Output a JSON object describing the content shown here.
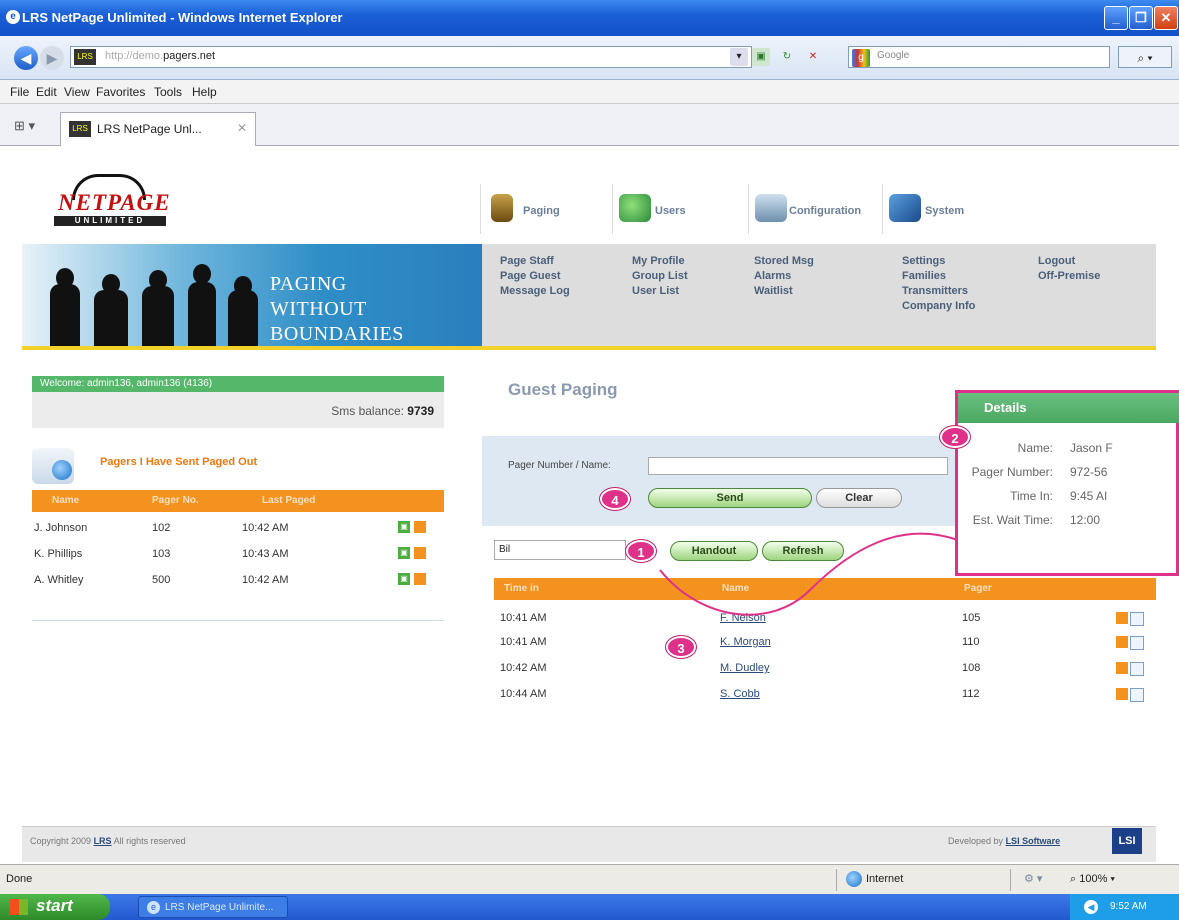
{
  "window": {
    "title": "LRS NetPage Unlimited - Windows Internet Explorer"
  },
  "browser": {
    "url_faded": "http://demo.",
    "url_host": "pagers.net",
    "search_placeholder": "Google",
    "menu": [
      "File",
      "Edit",
      "View",
      "Favorites",
      "Tools",
      "Help"
    ],
    "tab_title": "LRS NetPage Unl...",
    "tab_close": "✕"
  },
  "logo": {
    "word": "NETPAGE",
    "sub": "UNLIMITED"
  },
  "banner": {
    "line1": "PAGING",
    "line2": "WITHOUT BOUNDARIES"
  },
  "nav": {
    "tabs": [
      "Paging",
      "Users",
      "Configuration",
      "System"
    ],
    "columns": [
      [
        "Page Staff",
        "Page Guest",
        "Message Log"
      ],
      [
        "My Profile",
        "Group List",
        "User List"
      ],
      [
        "Stored Msg",
        "Alarms",
        "Waitlist"
      ],
      [
        "Settings",
        "Families",
        "Transmitters",
        "Company Info"
      ],
      [
        "Logout",
        "Off-Premise"
      ]
    ]
  },
  "sidebar": {
    "welcome": "Welcome: admin136, admin136 (4136)",
    "sms_label": "Sms balance:",
    "sms_value": "9739",
    "paged_label": "Pagers I Have Sent Paged Out",
    "table_headers": [
      "Name",
      "Pager No.",
      "Last Paged"
    ],
    "rows": [
      {
        "name": "J. Johnson",
        "pager": "102",
        "time": "10:42 AM"
      },
      {
        "name": "K. Phillips",
        "pager": "103",
        "time": "10:43 AM"
      },
      {
        "name": "A. Whitley",
        "pager": "500",
        "time": "10:42 AM"
      }
    ]
  },
  "guest": {
    "title": "Guest Paging",
    "pager_label": "Pager Number / Name:",
    "send": "Send",
    "clear": "Clear",
    "filter_value": "Bil",
    "handout": "Handout",
    "refresh": "Refresh",
    "table_headers": [
      "Time in",
      "Name",
      "Pager"
    ],
    "rows": [
      {
        "time": "10:41 AM",
        "name": "F. Nelson",
        "pager": "105"
      },
      {
        "time": "10:41 AM",
        "name": "K. Morgan",
        "pager": "110"
      },
      {
        "time": "10:42 AM",
        "name": "M. Dudley",
        "pager": "108"
      },
      {
        "time": "10:44 AM",
        "name": "S. Cobb",
        "pager": "112"
      }
    ]
  },
  "details": {
    "title": "Details",
    "rows": [
      {
        "label": "Name:",
        "value": "Jason F"
      },
      {
        "label": "Pager Number:",
        "value": "972-56"
      },
      {
        "label": "Time In:",
        "value": "9:45 AI"
      },
      {
        "label": "Est. Wait Time:",
        "value": "12:00"
      }
    ]
  },
  "badges": [
    "1",
    "2",
    "3",
    "4"
  ],
  "footer": {
    "copyright_prefix": "Copyright 2009",
    "copyright_link": "LRS",
    "copyright_suffix": "All rights reserved",
    "dev_prefix": "Developed by",
    "dev_link": "LSI Software",
    "lsi_logo": "LSI"
  },
  "status": {
    "done": "Done",
    "zone": "Internet",
    "zoom": "100%"
  },
  "taskbar": {
    "start": "start",
    "task": "LRS NetPage Unlimite...",
    "clock": "9:52 AM"
  },
  "colors": {
    "accent_orange": "#f3921f",
    "welcome_green": "#55b76a",
    "callout_pink": "#e0318a",
    "yellow_rule": "#f1d12a"
  }
}
